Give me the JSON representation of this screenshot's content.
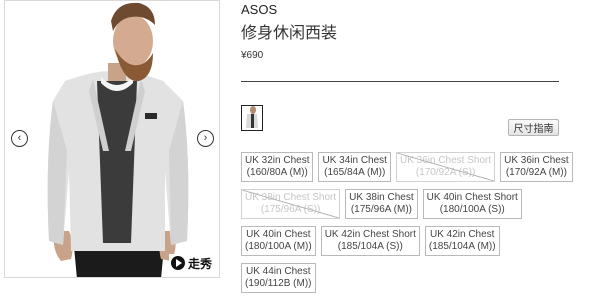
{
  "product": {
    "brand": "ASOS",
    "title": "修身休闲西装",
    "price": "¥690"
  },
  "gallery": {
    "prev_icon": "chevron-left-icon",
    "next_icon": "chevron-right-icon",
    "video_label": "走秀",
    "video_icon": "play-icon"
  },
  "size_guide_label": "尺寸指南",
  "sizes": [
    [
      {
        "line1": "UK 32in Chest",
        "line2": "(160/80A (M))",
        "available": true
      },
      {
        "line1": "UK 34in Chest",
        "line2": "(165/84A (M))",
        "available": true
      },
      {
        "line1": "UK 36in Chest Short",
        "line2": "(170/92A (S))",
        "available": false
      },
      {
        "line1": "UK 36in Chest",
        "line2": "(170/92A (M))",
        "available": true
      }
    ],
    [
      {
        "line1": "UK 38in Chest Short",
        "line2": "(175/96A (S))",
        "available": false
      },
      {
        "line1": "UK 38in Chest",
        "line2": "(175/96A (M))",
        "available": true
      },
      {
        "line1": "UK 40in Chest Short",
        "line2": "(180/100A (S))",
        "available": true
      }
    ],
    [
      {
        "line1": "UK 40in Chest",
        "line2": "(180/100A (M))",
        "available": true
      },
      {
        "line1": "UK 42in Chest Short",
        "line2": "(185/104A (S))",
        "available": true
      },
      {
        "line1": "UK 42in Chest",
        "line2": "(185/104A (M))",
        "available": true
      }
    ],
    [
      {
        "line1": "UK 44in Chest",
        "line2": "(190/112B (M))",
        "available": true
      }
    ]
  ],
  "colors": {
    "border": "#b9b9b9",
    "disabled_text": "#c6c6c6",
    "divider": "#444444"
  }
}
